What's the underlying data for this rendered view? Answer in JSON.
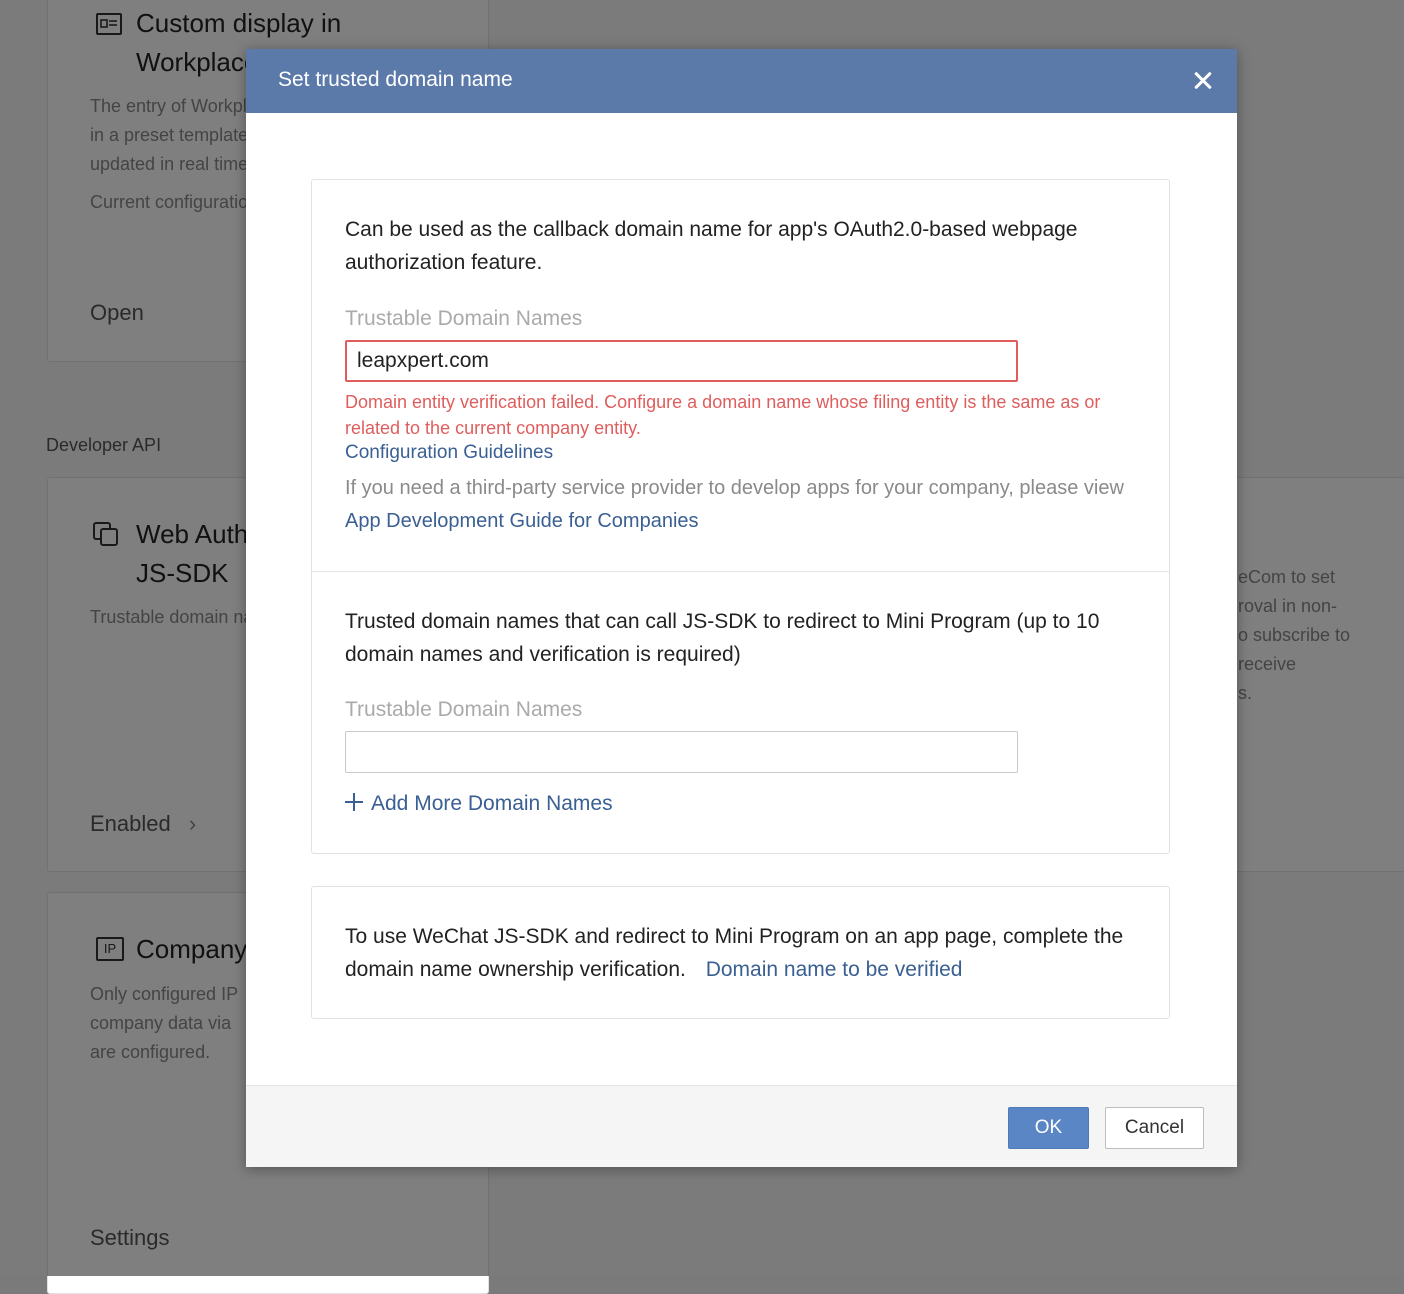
{
  "background": {
    "card1": {
      "icon": "layout-icon",
      "title_line1": "Custom display in",
      "title_line2": "Workplace",
      "desc_lines": [
        "The entry of Workplace",
        "in a preset template",
        "updated in real time"
      ],
      "config": "Current configuration",
      "action": "Open"
    },
    "section_label": "Developer API",
    "card2": {
      "icon": "copy-icon",
      "title_line1": "Web Authorization and",
      "title_line2": "JS-SDK",
      "desc": "Trustable domain name",
      "action": "Enabled",
      "action_chevron": "›"
    },
    "card2_right_lines": [
      "eCom to set",
      "roval in non-",
      "o subscribe to",
      "receive",
      "s."
    ],
    "card3": {
      "icon_text": "IP",
      "title": "Company",
      "desc_lines": [
        "Only configured IP",
        "company data via",
        "are configured."
      ],
      "action": "Settings"
    }
  },
  "modal": {
    "title": "Set trusted domain name",
    "oauth_section": {
      "description": "Can be used as the callback domain name for app's OAuth2.0-based webpage authorization feature.",
      "field_label": "Trustable Domain Names",
      "field_value": "leapxpert.com",
      "error": "Domain entity verification failed. Configure a domain name whose filing entity is the same as or related to the current company entity.",
      "guidelines_link": "Configuration Guidelines",
      "third_party_text": "If you need a third-party service provider to develop apps for your company, please view",
      "third_party_link": "App Development Guide for Companies"
    },
    "jssdk_section": {
      "description": "Trusted domain names that can call JS-SDK to redirect to Mini Program (up to 10 domain names and verification is required)",
      "field_label": "Trustable Domain Names",
      "field_value": "",
      "add_more": "Add More Domain Names"
    },
    "verification_panel": {
      "text": "To use WeChat JS-SDK and redirect to Mini Program on an app page, complete the domain name ownership verification.",
      "link": "Domain name to be verified"
    },
    "buttons": {
      "ok": "OK",
      "cancel": "Cancel"
    }
  },
  "colors": {
    "header": "#5c7aa9",
    "link": "#3a5f93",
    "error": "#e05d5d",
    "primary_button": "#5b86c5"
  }
}
